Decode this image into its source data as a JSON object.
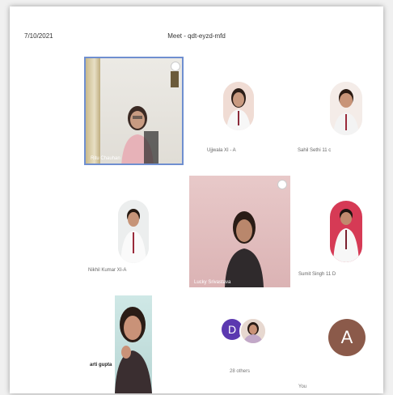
{
  "header": {
    "date": "7/10/2021",
    "meeting_title": "Meet - qdt-eyzd-mfd"
  },
  "tiles": {
    "video_1_label": "Ritu Chauhan",
    "video_2_label": "Lucky Srivastava",
    "video_3_label": "arti gupta",
    "participant_ujjwala": "Ujjwala XI - A",
    "participant_sahil": "Sahil Sethi 11 c",
    "participant_nikhil": "Nikhil Kumar XI-A",
    "participant_sumit": "Sumit Singh 11 D"
  },
  "others": {
    "avatar_letter": "D",
    "count_label": "28 others"
  },
  "self": {
    "avatar_letter": "A",
    "label": "You"
  }
}
